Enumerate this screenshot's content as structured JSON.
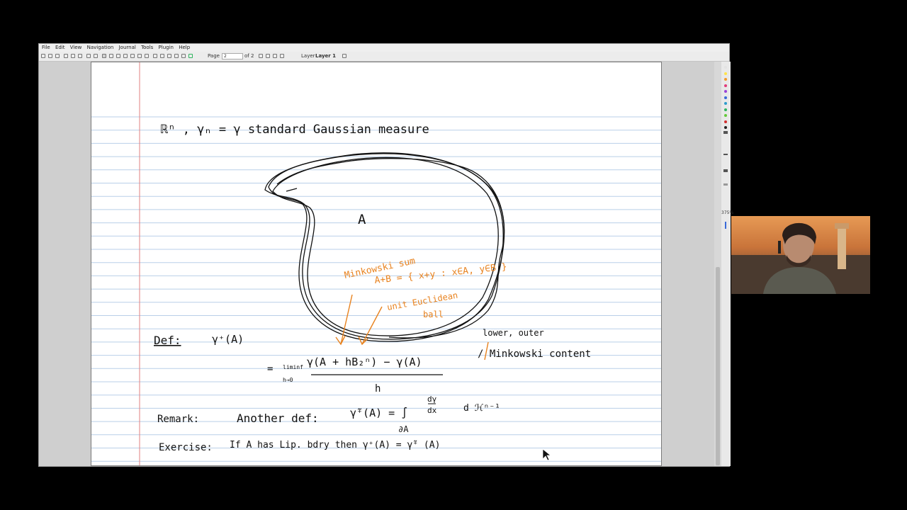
{
  "menu": [
    "File",
    "Edit",
    "View",
    "Navigation",
    "Journal",
    "Tools",
    "Plugin",
    "Help"
  ],
  "toolbar": {
    "page_label": "Page",
    "page_value": "2",
    "page_of": "of 2",
    "layer_label": "Layer",
    "layer_value": "Layer 1"
  },
  "sidepanel": {
    "zoom": "375%"
  },
  "colors": {
    "ink": "#111111",
    "annotation": "#e8821e",
    "ruling": "#b9cfe8",
    "margin": "#e08080",
    "palette": [
      "#e3e3e3",
      "#ffe44a",
      "#f39a2b",
      "#e13b7b",
      "#9b42d8",
      "#3a6ad8",
      "#2e9ccc",
      "#2fb55f",
      "#64c93a",
      "#d12f2f",
      "#222222"
    ]
  },
  "notes": {
    "line1": "ℝⁿ ,  γₙ = γ     standard  Gaussian  measure",
    "set_label": "A",
    "minkowski1": "Minkowski sum",
    "minkowski2": "A+B = { x+y  :  x∈A, y∈B }",
    "unit_ball1": "unit Euclidean",
    "unit_ball2": "ball",
    "def_label": "Def:",
    "def_expr": "γ⁺(A)",
    "limit_eq": "=",
    "liminf": "liminf",
    "liminf_sub": "h→0",
    "numerator": "γ(A + hB₂ⁿ)  −  γ(A)",
    "denominator": "h",
    "lower_outer": "lower, outer",
    "minkowski_content": "/ Minkowski content",
    "remark_label": "Remark:",
    "remark_text": "Another   def:",
    "remark_expr": "γ̃⁺(A) = ∫",
    "remark_frac_num": "dγ",
    "remark_frac_den": "dx",
    "remark_tail": "d ℋⁿ⁻¹",
    "remark_sub": "∂A",
    "exercise_label": "Exercise:",
    "exercise_text": "If   A   has   Lip.  bdry   then     γ⁺(A) = γ̃⁺ (A)"
  }
}
